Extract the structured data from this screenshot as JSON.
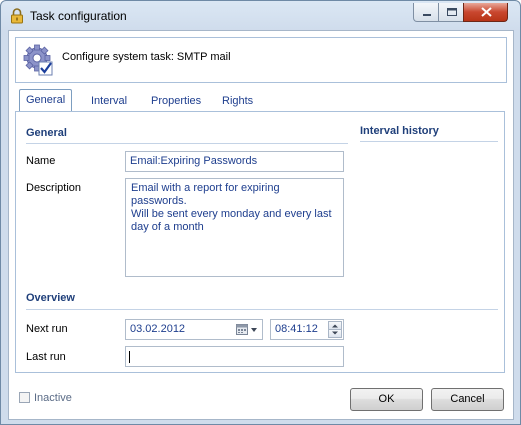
{
  "window": {
    "title": "Task configuration"
  },
  "header": {
    "text": "Configure system task: SMTP mail"
  },
  "tabs": [
    {
      "label": "General",
      "active": true
    },
    {
      "label": "Interval",
      "active": false
    },
    {
      "label": "Properties",
      "active": false
    },
    {
      "label": "Rights",
      "active": false
    }
  ],
  "general": {
    "section_title": "General",
    "name_label": "Name",
    "name_value": "Email:Expiring Passwords",
    "description_label": "Description",
    "description_value": "Email with a report for expiring passwords.\nWill be sent every monday and every last\nday of a month"
  },
  "overview": {
    "section_title": "Overview",
    "next_run_label": "Next run",
    "next_run_date": "03.02.2012",
    "next_run_time": "08:41:12",
    "last_run_label": "Last run",
    "last_run_value": ""
  },
  "interval_history": {
    "title": "Interval history"
  },
  "footer": {
    "inactive_label": "Inactive",
    "inactive_checked": false,
    "ok_label": "OK",
    "cancel_label": "Cancel"
  },
  "colors": {
    "accent": "#1f3f7a",
    "tab_text": "#1e3e8e"
  }
}
